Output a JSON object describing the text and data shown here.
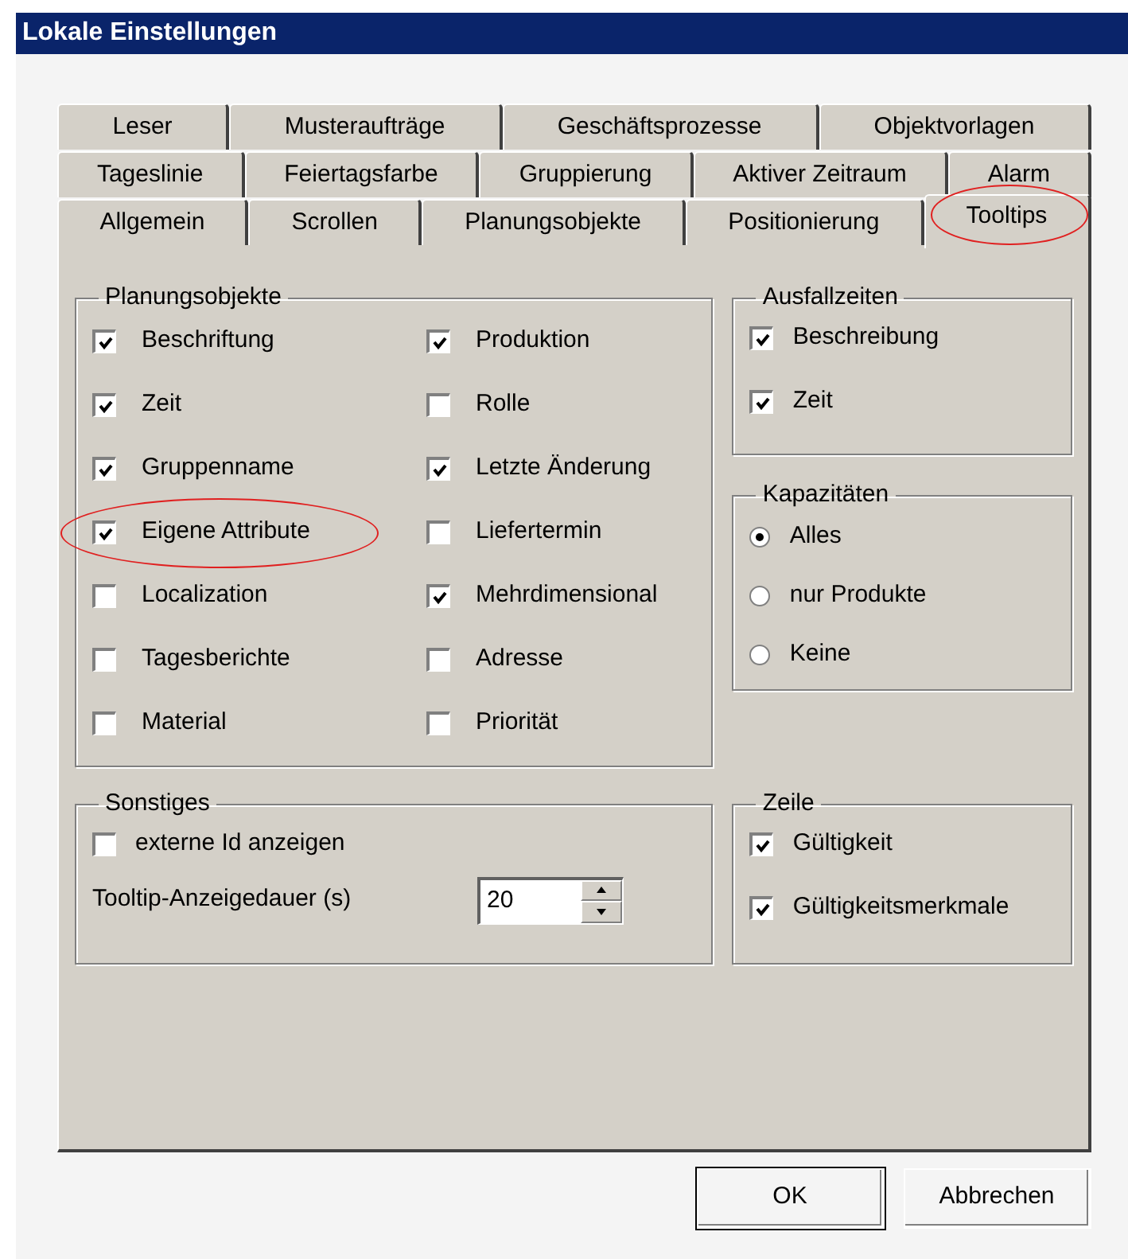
{
  "window": {
    "title": "Lokale Einstellungen"
  },
  "tab_rows": [
    [
      {
        "label": "Leser",
        "selected": false,
        "annotated": false
      },
      {
        "label": "Musteraufträge",
        "selected": false,
        "annotated": false
      },
      {
        "label": "Geschäftsprozesse",
        "selected": false,
        "annotated": false
      },
      {
        "label": "Objektvorlagen",
        "selected": false,
        "annotated": false
      }
    ],
    [
      {
        "label": "Tageslinie",
        "selected": false,
        "annotated": false
      },
      {
        "label": "Feiertagsfarbe",
        "selected": false,
        "annotated": false
      },
      {
        "label": "Gruppierung",
        "selected": false,
        "annotated": false
      },
      {
        "label": "Aktiver Zeitraum",
        "selected": false,
        "annotated": false
      },
      {
        "label": "Alarm",
        "selected": false,
        "annotated": false
      }
    ],
    [
      {
        "label": "Allgemein",
        "selected": false,
        "annotated": false
      },
      {
        "label": "Scrollen",
        "selected": false,
        "annotated": false
      },
      {
        "label": "Planungsobjekte",
        "selected": false,
        "annotated": false
      },
      {
        "label": "Positionierung",
        "selected": false,
        "annotated": false
      },
      {
        "label": "Tooltips",
        "selected": true,
        "annotated": true
      }
    ]
  ],
  "planungsobjekte": {
    "title": "Planungsobjekte",
    "items": [
      {
        "label": "Beschriftung",
        "checked": true,
        "annotated": false
      },
      {
        "label": "Produktion",
        "checked": true,
        "annotated": false
      },
      {
        "label": "Zeit",
        "checked": true,
        "annotated": false
      },
      {
        "label": "Rolle",
        "checked": false,
        "annotated": false
      },
      {
        "label": "Gruppenname",
        "checked": true,
        "annotated": false
      },
      {
        "label": "Letzte Änderung",
        "checked": true,
        "annotated": false
      },
      {
        "label": "Eigene Attribute",
        "checked": true,
        "annotated": true
      },
      {
        "label": "Liefertermin",
        "checked": false,
        "annotated": false
      },
      {
        "label": "Localization",
        "checked": false,
        "annotated": false
      },
      {
        "label": "Mehrdimensional",
        "checked": true,
        "annotated": false
      },
      {
        "label": "Tagesberichte",
        "checked": false,
        "annotated": false
      },
      {
        "label": "Adresse",
        "checked": false,
        "annotated": false
      },
      {
        "label": "Material",
        "checked": false,
        "annotated": false
      },
      {
        "label": "Priorität",
        "checked": false,
        "annotated": false
      }
    ]
  },
  "ausfallzeiten": {
    "title": "Ausfallzeiten",
    "items": [
      {
        "label": "Beschreibung",
        "checked": true
      },
      {
        "label": "Zeit",
        "checked": true
      }
    ]
  },
  "kapazitaeten": {
    "title": "Kapazitäten",
    "options": [
      {
        "label": "Alles",
        "selected": true
      },
      {
        "label": "nur Produkte",
        "selected": false
      },
      {
        "label": "Keine",
        "selected": false
      }
    ]
  },
  "sonstiges": {
    "title": "Sonstiges",
    "checkbox": {
      "label": "externe Id anzeigen",
      "checked": false
    },
    "spinner": {
      "label": "Tooltip-Anzeigedauer (s)",
      "value": "20"
    }
  },
  "zeile": {
    "title": "Zeile",
    "items": [
      {
        "label": "Gültigkeit",
        "checked": true
      },
      {
        "label": "Gültigkeitsmerkmale",
        "checked": true
      }
    ]
  },
  "buttons": [
    {
      "label": "OK",
      "default": true
    },
    {
      "label": "Abbrechen",
      "default": false
    }
  ]
}
